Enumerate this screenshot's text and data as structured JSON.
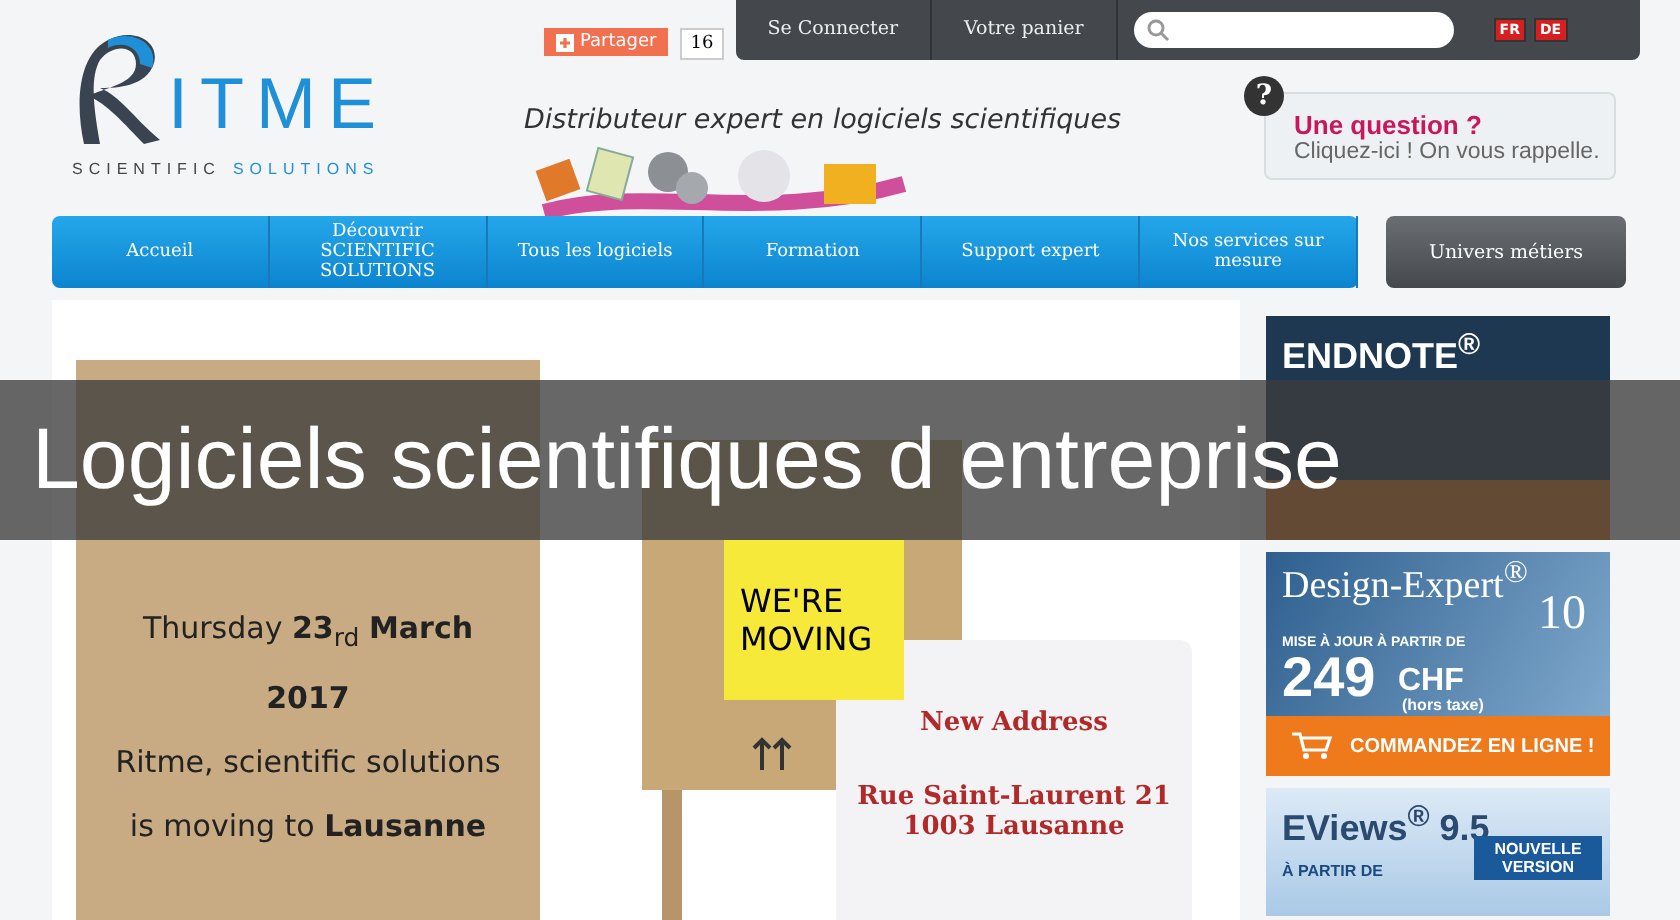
{
  "logo": {
    "wordmark": "ITME",
    "subtitle_first": "SCIENTIFIC",
    "subtitle_second": "SOLUTIONS"
  },
  "top_bar": {
    "share_button": "Partager",
    "share_count": "16",
    "links": [
      "Se Connecter",
      "Votre panier"
    ],
    "languages": [
      "FR",
      "DE"
    ]
  },
  "tagline": "Distributeur expert en logiciels scientifiques",
  "callback": {
    "icon": "?",
    "title": "Une question ?",
    "text": "Cliquez-ici ! On vous rappelle."
  },
  "nav": {
    "items": [
      "Accueil",
      "Découvrir SCIENTIFIC SOLUTIONS",
      "Tous les logiciels",
      "Formation",
      "Support expert",
      "Nos services sur mesure"
    ],
    "secondary": "Univers métiers"
  },
  "slide": {
    "poster_lines": [
      "Thursday **23**$_{rd}$ **March**",
      "**2017**",
      "Ritme, scientific solutions",
      "is moving to **Lausanne**"
    ],
    "note": [
      "WE'RE",
      "MOVING"
    ],
    "sign": {
      "title": "New Address",
      "lines": [
        "Rue Saint-Laurent 21",
        "1003 Lausanne"
      ]
    }
  },
  "ads": [
    {
      "kind": "endnote",
      "title": "ENDNOTE$^{®}$"
    },
    {
      "kind": "design",
      "title": "Design-Expert$^{®}$",
      "version": "10",
      "lines": [
        "MISE À JOUR À PARTIR DE",
        "249",
        "CHF",
        "(hors taxe)"
      ],
      "action": "COMMANDEZ EN LIGNE !"
    },
    {
      "kind": "eviews",
      "title": "EViews$^{®}$ 9.5",
      "lines": [
        "À PARTIR DE"
      ],
      "badge": "NOUVELLE VERSION"
    }
  ],
  "banner": "Logiciels scientifiques d entreprise"
}
